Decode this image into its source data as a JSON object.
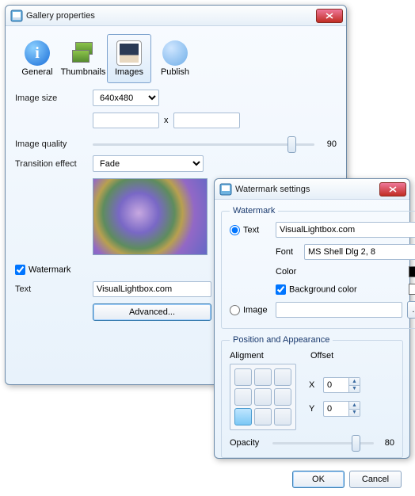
{
  "win1": {
    "title": "Gallery properties",
    "tabs": [
      {
        "label": "General"
      },
      {
        "label": "Thumbnails"
      },
      {
        "label": "Images"
      },
      {
        "label": "Publish"
      }
    ],
    "imageSizeLabel": "Image size",
    "imageSizeValue": "640x480",
    "widthValue": "",
    "heightValue": "",
    "xSep": "x",
    "imageQualityLabel": "Image quality",
    "imageQualityValue": "90",
    "transitionLabel": "Transition effect",
    "transitionValue": "Fade",
    "watermarkLabel": "Watermark",
    "textLabel": "Text",
    "textValue": "VisualLightbox.com",
    "advancedLabel": "Advanced..."
  },
  "win2": {
    "title": "Watermark settings",
    "groupWatermark": "Watermark",
    "radioTextLabel": "Text",
    "textValue": "VisualLightbox.com",
    "fontLabel": "Font",
    "fontValue": "MS Shell Dlg 2, 8",
    "colorLabel": "Color",
    "colorValue": "#000000",
    "bgColorLabel": "Background color",
    "bgColorValue": "#ffffff",
    "radioImageLabel": "Image",
    "imageValue": "",
    "browseLabel": "...",
    "groupPos": "Position and Appearance",
    "alignLabel": "Aligment",
    "offsetLabel": "Offset",
    "xLabel": "X",
    "xValue": "0",
    "yLabel": "Y",
    "yValue": "0",
    "opacityLabel": "Opacity",
    "opacityValue": "80",
    "okLabel": "OK",
    "cancelLabel": "Cancel"
  }
}
